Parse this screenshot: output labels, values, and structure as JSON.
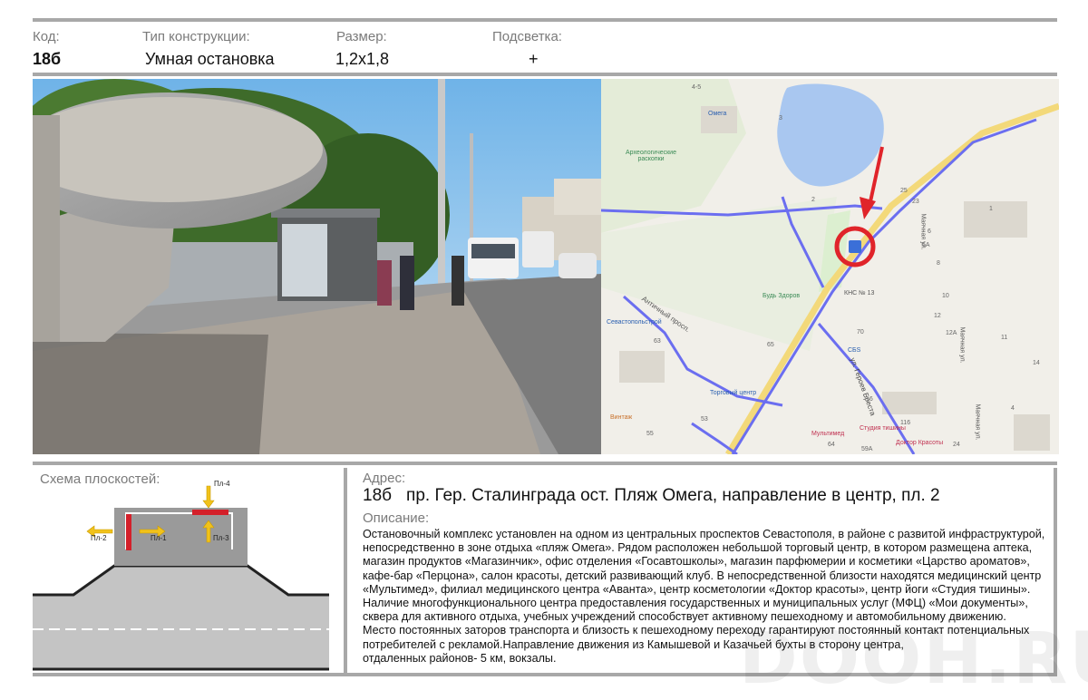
{
  "header": {
    "code_label": "Код:",
    "code_value": "18б",
    "type_label": "Тип конструкции:",
    "type_value": "Умная остановка",
    "size_label": "Размер:",
    "size_value": "1,2х1,8",
    "light_label": "Подсветка:",
    "light_value": "+"
  },
  "map": {
    "labels": {
      "archaeo": "Археологические раскопки",
      "sev": "Севастопольстрой",
      "antich": "Античный просп.",
      "bud": "Будь Здоров",
      "kns": "КНС № 13",
      "sbs": "СБS",
      "trade": "Торговый центр",
      "vintage": "Винтаж",
      "mayach1": "Маячная ул.",
      "mayach2": "Маячная ул.",
      "mayach3": "Маячная ул.",
      "geroev": "ул. Героев Бреста",
      "multimed": "Мультимед",
      "doctor": "Доктор Красоты",
      "studio": "Студия тишины",
      "omega": "Омега"
    },
    "numbers": [
      "4-5",
      "3",
      "2",
      "1",
      "6",
      "6А",
      "12",
      "10",
      "12А",
      "11",
      "14",
      "70",
      "16",
      "65",
      "63",
      "53",
      "55",
      "64",
      "59А",
      "116",
      "24",
      "4",
      "25",
      "23",
      "8"
    ]
  },
  "scheme": {
    "title": "Схема плоскостей:",
    "planes": [
      "Пл-1",
      "Пл-2",
      "Пл-3",
      "Пл-4"
    ]
  },
  "address": {
    "label": "Адрес:",
    "code": "18б",
    "text": "пр. Гер. Сталинграда ост. Пляж Омега, направление в центр, пл. 2"
  },
  "description": {
    "label": "Описание:",
    "lines": [
      "Остановочный комплекс установлен на одном из центральных проспектов Севастополя, в районе с развитой инфраструктурой,",
      "непосредственно в зоне отдыха  «пляж Омега». Рядом расположен небольшой торговый центр, в котором размещена аптека,",
      "магазин продуктов «Магазинчик», офис  отделения «Госавтошколы»,  магазин парфюмерии и косметики «Царство ароматов»,",
      "кафе-бар «Перцона», салон красоты, детский развивающий клуб. В непосредственной близости находятся медицинский центр",
      "«Мультимед», филиал медицинского центра «Аванта», центр косметологии «Доктор красоты», центр йоги «Студия тишины».",
      "Наличие многофункционального центра предоставления государственных и муниципальных услуг (МФЦ) «Мои документы»,",
      "сквера для активного отдыха,  учебных учреждений способствует активному пешеходному и автомобильному движению.",
      "Место постоянных заторов транспорта и близость к пешеходному переходу гарантируют постоянный контакт потенциальных",
      "потребителей с рекламой.Направление движения из Камышевой и Казачьей бухты в сторону центра,",
      "отдаленных районов-  5 км, вокзалы."
    ]
  },
  "watermark": "DOOH.RU",
  "colors": {
    "route": "#6b6ef0",
    "marker": "#e0242a",
    "water": "#a9c7f0",
    "plane": "#d4202a",
    "arrow": "#f1c21b"
  }
}
